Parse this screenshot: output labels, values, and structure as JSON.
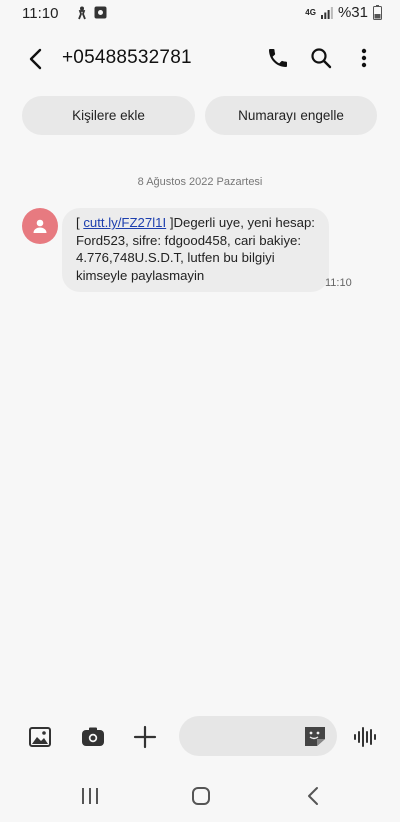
{
  "status_bar": {
    "time": "11:10",
    "network": "4G",
    "battery": "%31",
    "icons": [
      "person-walk-icon",
      "photo-notification-icon",
      "signal-icon",
      "battery-icon"
    ]
  },
  "header": {
    "contact_number": "+05488532781",
    "icons": [
      "back-arrow-icon",
      "phone-icon",
      "search-icon",
      "more-vertical-icon"
    ]
  },
  "actions": {
    "add_contact": "Kişilere ekle",
    "block_number": "Numarayı engelle"
  },
  "conversation": {
    "date_separator": "8 Ağustos 2022 Pazartesi",
    "messages": [
      {
        "prefix": "[ ",
        "link": "cutt.ly/FZ27l1I",
        "body": " ]Degerli uye, yeni hesap: Ford523, sifre: fdgood458, cari bakiye: 4.776,748U.S.D.T, lutfen bu bilgiyi kimseyle paylasmayin",
        "time": "11:10"
      }
    ]
  },
  "composer": {
    "input_value": "",
    "input_placeholder": "",
    "icons": [
      "gallery-icon",
      "camera-icon",
      "plus-icon",
      "sticker-icon",
      "voice-icon"
    ]
  },
  "nav_bar": {
    "icons": [
      "recents-icon",
      "home-icon",
      "back-icon"
    ]
  },
  "colors": {
    "background": "#f7f7f7",
    "pill": "#e8e8e8",
    "bubble": "#ececec",
    "avatar": "#e77a80",
    "link": "#1d3fae"
  }
}
